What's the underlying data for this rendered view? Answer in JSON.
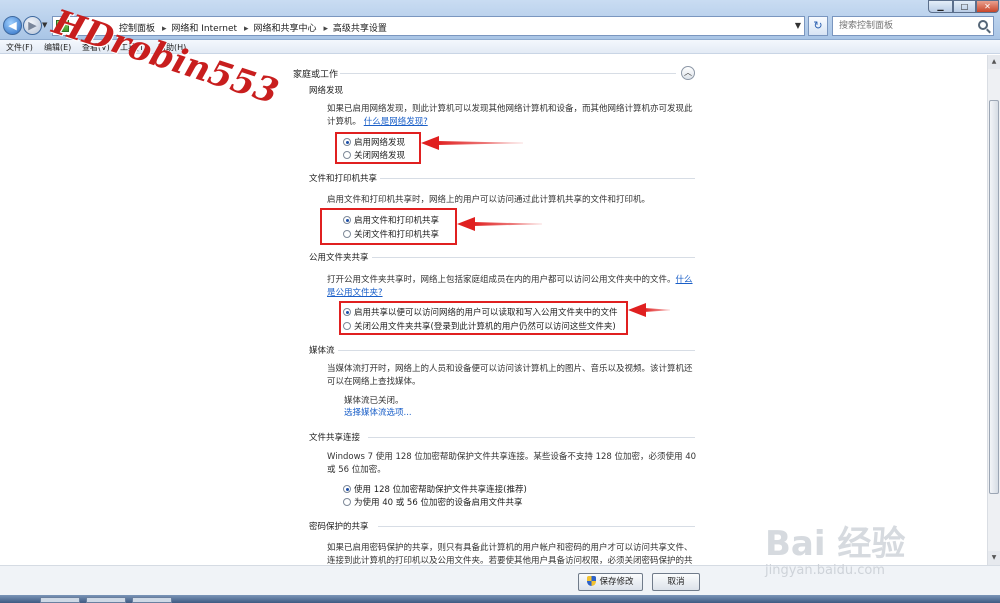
{
  "window": {
    "breadcrumb": [
      "控制面板",
      "网络和 Internet",
      "网络和共享中心",
      "高级共享设置"
    ],
    "search_placeholder": "搜索控制面板"
  },
  "menu": [
    "文件(F)",
    "编辑(E)",
    "查看(V)",
    "工具(T)",
    "帮助(H)"
  ],
  "watermark_text": "HDrobin553",
  "profile": {
    "title": "家庭或工作"
  },
  "sections": {
    "discovery": {
      "title": "网络发现",
      "desc": "如果已启用网络发现，则此计算机可以发现其他网络计算机和设备，而其他网络计算机亦可发现此计算机。",
      "link": "什么是网络发现?",
      "options": [
        "启用网络发现",
        "关闭网络发现"
      ]
    },
    "fileprint": {
      "title": "文件和打印机共享",
      "desc": "启用文件和打印机共享时，网络上的用户可以访问通过此计算机共享的文件和打印机。",
      "options": [
        "启用文件和打印机共享",
        "关闭文件和打印机共享"
      ]
    },
    "publicfolder": {
      "title": "公用文件夹共享",
      "desc": "打开公用文件夹共享时，网络上包括家庭组成员在内的用户都可以访问公用文件夹中的文件。",
      "link1": "什么",
      "link2": "是公用文件夹?",
      "options": [
        "启用共享以便可以访问网络的用户可以读取和写入公用文件夹中的文件",
        "关闭公用文件夹共享(登录到此计算机的用户仍然可以访问这些文件夹)"
      ]
    },
    "media": {
      "title": "媒体流",
      "desc": "当媒体流打开时，网络上的人员和设备便可以访问该计算机上的图片、音乐以及视频。该计算机还可以在网络上查找媒体。",
      "status": "媒体流已关闭。",
      "link": "选择媒体流选项..."
    },
    "encryption": {
      "title": "文件共享连接",
      "desc": "Windows 7 使用 128 位加密帮助保护文件共享连接。某些设备不支持 128 位加密，必须使用 40 或 56 位加密。",
      "options": [
        "使用 128 位加密帮助保护文件共享连接(推荐)",
        "为使用 40 或 56 位加密的设备启用文件共享"
      ]
    },
    "password": {
      "title": "密码保护的共享",
      "desc": "如果已启用密码保护的共享，则只有具备此计算机的用户帐户和密码的用户才可以访问共享文件、连接到此计算机的打印机以及公用文件夹。若要使其他用户具备访问权限，必须关闭密码保护的共"
    }
  },
  "buttons": {
    "save": "保存修改",
    "cancel": "取消"
  },
  "baidu": {
    "text": "Bai 经验",
    "url": "jingyan.baidu.com"
  },
  "colors": {
    "accent": "#1a5fc8",
    "annotation": "#e02020"
  }
}
